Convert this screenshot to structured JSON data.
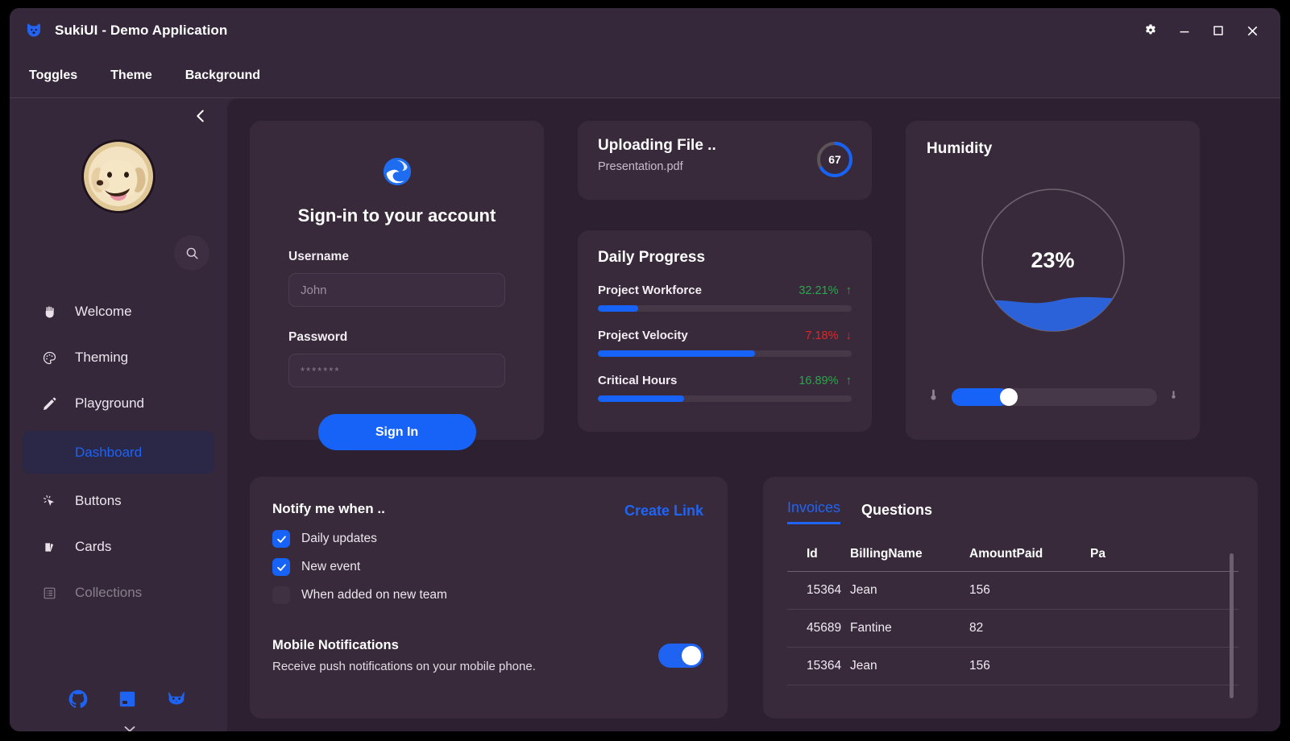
{
  "window": {
    "title": "SukiUI - Demo Application",
    "app_icon": "dog-logo-icon",
    "controls": {
      "settings": "gear-icon",
      "minimize": "minimize-icon",
      "maximize": "maximize-icon",
      "close": "close-icon"
    }
  },
  "menubar": {
    "items": [
      {
        "label": "Toggles"
      },
      {
        "label": "Theme"
      },
      {
        "label": "Background"
      }
    ]
  },
  "sidebar": {
    "collapse_icon": "chevron-left-icon",
    "avatar": "dog-avatar",
    "search_icon": "search-icon",
    "expand_icon": "chevron-down-icon",
    "items": [
      {
        "label": "Welcome",
        "icon": "hand-icon",
        "selected": false
      },
      {
        "label": "Theming",
        "icon": "palette-icon",
        "selected": false
      },
      {
        "label": "Playground",
        "icon": "pencil-icon",
        "selected": false
      },
      {
        "label": "Dashboard",
        "icon": "",
        "selected": true
      },
      {
        "label": "Buttons",
        "icon": "cursor-click-icon",
        "selected": false
      },
      {
        "label": "Cards",
        "icon": "cards-icon",
        "selected": false
      },
      {
        "label": "Collections",
        "icon": "list-icon",
        "selected": false
      }
    ],
    "footer_icons": [
      "github-icon",
      "book-icon",
      "cat-icon"
    ]
  },
  "signin": {
    "logo": "edge-logo-icon",
    "title": "Sign-in to your account",
    "username_label": "Username",
    "username_placeholder": "John",
    "password_label": "Password",
    "password_value": "*******",
    "button_label": "Sign In"
  },
  "upload": {
    "title": "Uploading File ..",
    "filename": "Presentation.pdf",
    "progress": 67,
    "progress_label": "67"
  },
  "daily_progress": {
    "title": "Daily Progress",
    "rows": [
      {
        "name": "Project Workforce",
        "value": "32.21%",
        "direction": "up",
        "arrow": "↑",
        "bar": 16
      },
      {
        "name": "Project Velocity",
        "value": "7.18%",
        "direction": "down",
        "arrow": "↓",
        "bar": 62
      },
      {
        "name": "Critical Hours",
        "value": "16.89%",
        "direction": "up",
        "arrow": "↑",
        "bar": 34
      }
    ]
  },
  "humidity": {
    "title": "Humidity",
    "value_label": "23%",
    "value": 23,
    "slider_value": 28,
    "left_icon": "thermometer-icon",
    "right_icon": "thermometer-icon"
  },
  "notify": {
    "title": "Notify me when ..",
    "create_link_label": "Create Link",
    "checks": [
      {
        "label": "Daily updates",
        "checked": true
      },
      {
        "label": "New event",
        "checked": true
      },
      {
        "label": "When added on new team",
        "checked": false
      }
    ],
    "mobile_title": "Mobile Notifications",
    "mobile_sub": "Receive push notifications on your mobile phone.",
    "mobile_enabled": true
  },
  "invoices": {
    "tabs": [
      {
        "label": "Invoices",
        "active": true
      },
      {
        "label": "Questions",
        "active": false
      }
    ],
    "columns": [
      "Id",
      "BillingName",
      "AmountPaid",
      "Pa"
    ],
    "rows": [
      {
        "id": "15364",
        "name": "Jean",
        "amount": "156",
        "pa": ""
      },
      {
        "id": "45689",
        "name": "Fantine",
        "amount": "82",
        "pa": ""
      },
      {
        "id": "15364",
        "name": "Jean",
        "amount": "156",
        "pa": ""
      }
    ]
  },
  "colors": {
    "accent": "#1763f7",
    "page_bg": "#2d2030",
    "card_bg": "#382a3b",
    "chrome_bg": "#35283a",
    "positive": "#27a84a",
    "negative": "#e52424"
  }
}
